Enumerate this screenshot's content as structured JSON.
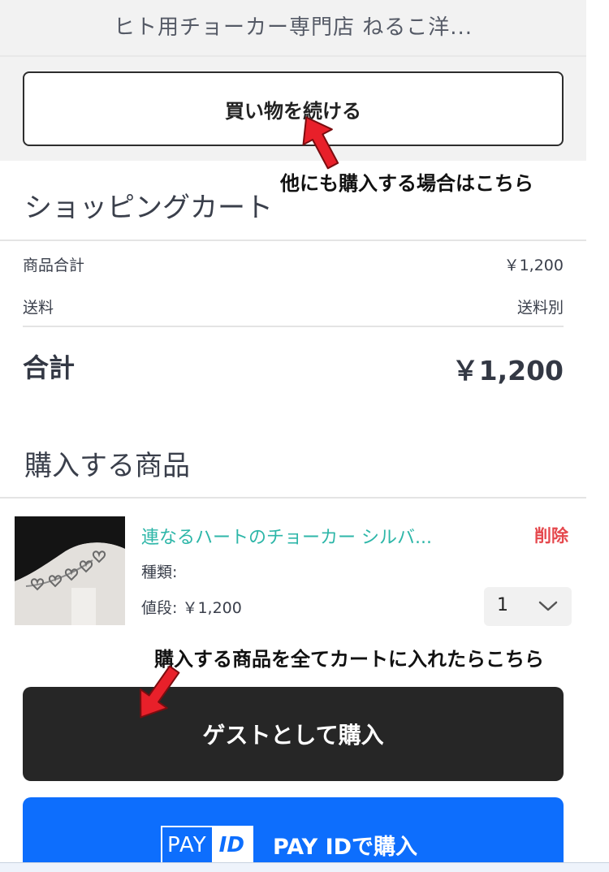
{
  "header": {
    "shop_name": "ヒト用チョーカー専門店 ねるこ洋..."
  },
  "continue_button": {
    "label": "買い物を続ける"
  },
  "annotations": {
    "continue_hint": "他にも購入する場合はこちら",
    "checkout_hint": "購入する商品を全てカートに入れたらこちら"
  },
  "cart": {
    "title": "ショッピングカート",
    "subtotal_label": "商品合計",
    "subtotal_value": "￥1,200",
    "shipping_label": "送料",
    "shipping_value": "送料別",
    "total_label": "合計",
    "total_value": "￥1,200"
  },
  "items_section": {
    "title": "購入する商品",
    "items": [
      {
        "name": "連なるハートのチョーカー シルバ...",
        "delete_label": "削除",
        "variant_label": "種類:",
        "price_label": "値段: ￥1,200",
        "quantity": "1",
        "thumbnail": "heart-choker-photo"
      }
    ]
  },
  "checkout": {
    "guest_label": "ゲストとして購入",
    "payid_logo_pay": "PAY",
    "payid_logo_id": "ID",
    "payid_label": "PAY IDで購入"
  },
  "colors": {
    "accent_teal": "#2db6a8",
    "delete_red": "#e5484d",
    "guest_button": "#262626",
    "payid_blue": "#0d6efd",
    "annotation_arrow": "#e8202a"
  },
  "icons": {
    "qty_dropdown": "chevron-down-icon",
    "annotation_arrow": "red-arrow-icon"
  }
}
